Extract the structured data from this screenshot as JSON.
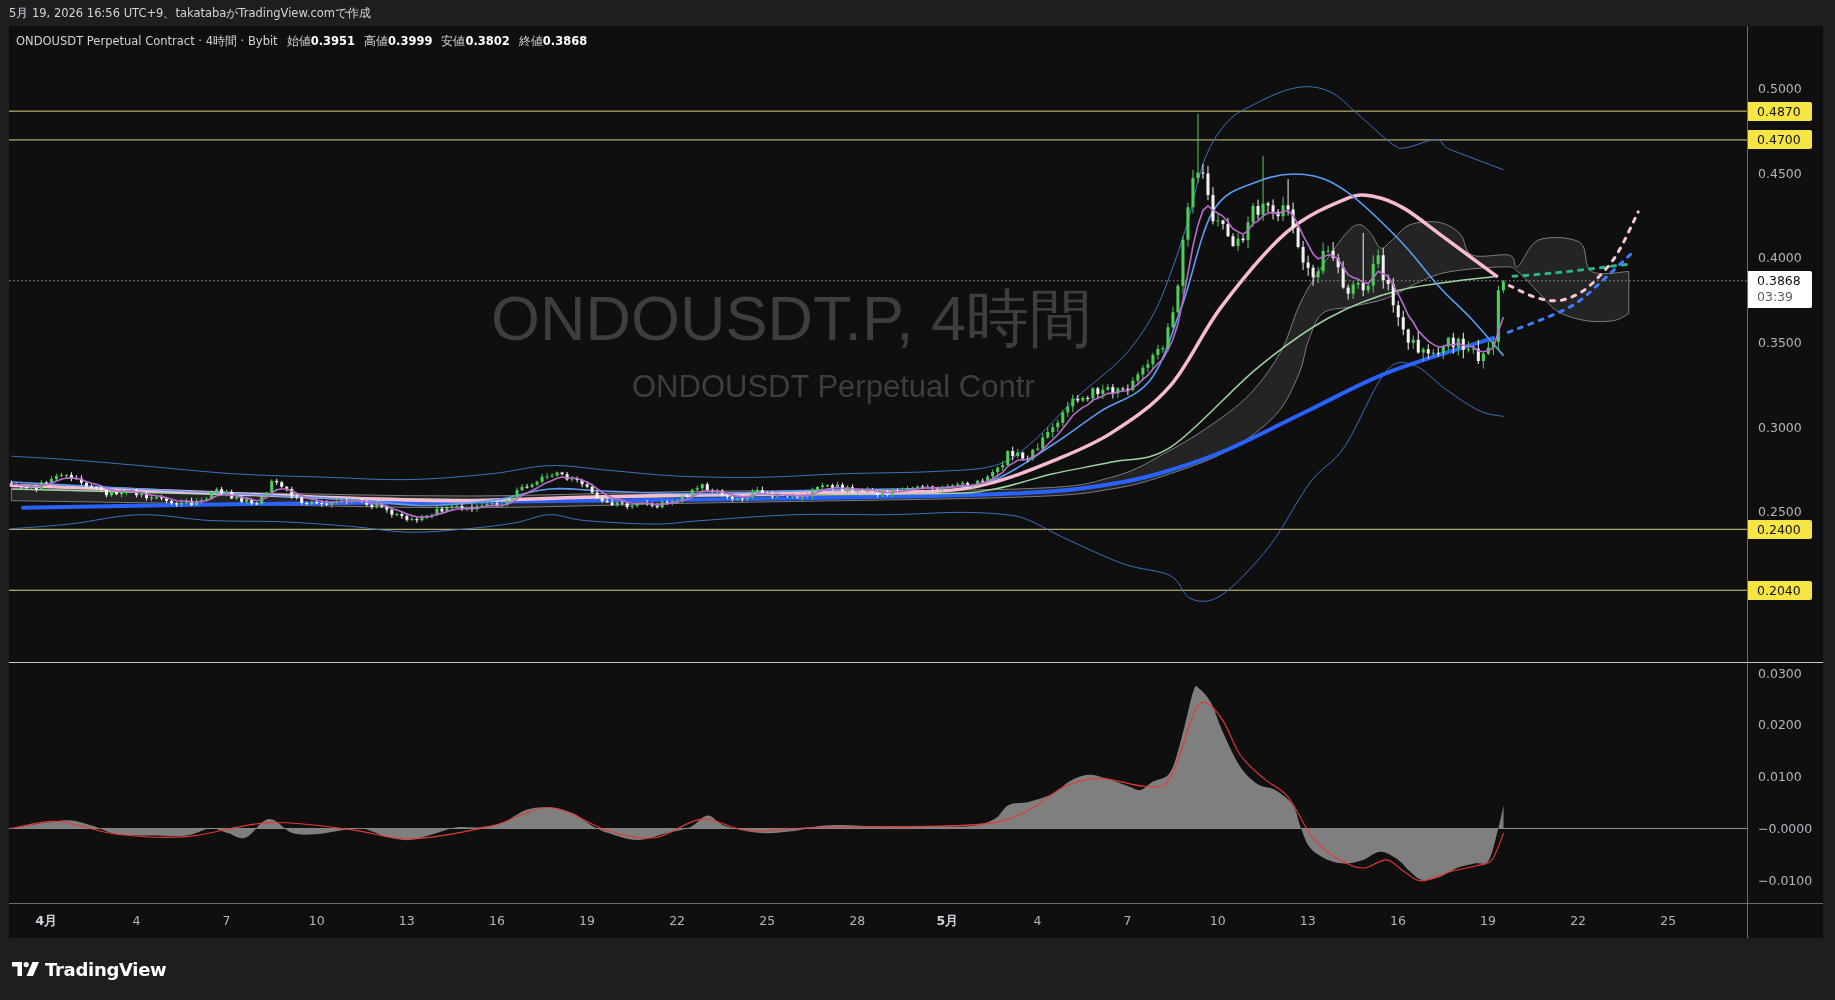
{
  "header": {
    "text": "5月 19, 2026 16:56 UTC+9、takatabaがTradingView.comで作成"
  },
  "legend": {
    "title": "ONDOUSDT Perpetual Contract · 4時間 · Bybit",
    "ohlc": [
      {
        "label": "始値",
        "value": "0.3951"
      },
      {
        "label": "高値",
        "value": "0.3999"
      },
      {
        "label": "安値",
        "value": "0.3802"
      },
      {
        "label": "終値",
        "value": "0.3868"
      }
    ]
  },
  "watermark": {
    "symbol": "ONDOUSDT.P, 4時間",
    "description": "ONDOUSDT Perpetual Contr"
  },
  "price_axis": {
    "ticks": [
      "0.5000",
      "0.4500",
      "0.4000",
      "0.3500",
      "0.3000",
      "0.2500"
    ],
    "levels": [
      "0.4870",
      "0.4700",
      "0.2400",
      "0.2040"
    ],
    "last_price": {
      "value": "0.3868",
      "countdown": "03:39"
    }
  },
  "oscillator_axis": {
    "ticks": [
      "0.0300",
      "0.0200",
      "0.0100",
      "−0.0000",
      "−0.0100"
    ]
  },
  "time_axis": [
    {
      "label": "4月",
      "kind": "month"
    },
    {
      "label": "4",
      "kind": "day"
    },
    {
      "label": "7",
      "kind": "day"
    },
    {
      "label": "10",
      "kind": "day"
    },
    {
      "label": "13",
      "kind": "day"
    },
    {
      "label": "16",
      "kind": "day"
    },
    {
      "label": "19",
      "kind": "day"
    },
    {
      "label": "22",
      "kind": "day"
    },
    {
      "label": "25",
      "kind": "day"
    },
    {
      "label": "28",
      "kind": "day"
    },
    {
      "label": "5月",
      "kind": "month"
    },
    {
      "label": "4",
      "kind": "day"
    },
    {
      "label": "7",
      "kind": "day"
    },
    {
      "label": "10",
      "kind": "day"
    },
    {
      "label": "13",
      "kind": "day"
    },
    {
      "label": "16",
      "kind": "day"
    },
    {
      "label": "19",
      "kind": "day"
    },
    {
      "label": "22",
      "kind": "day"
    },
    {
      "label": "25",
      "kind": "day"
    }
  ],
  "footer": {
    "logo_text": "TradingView"
  }
}
